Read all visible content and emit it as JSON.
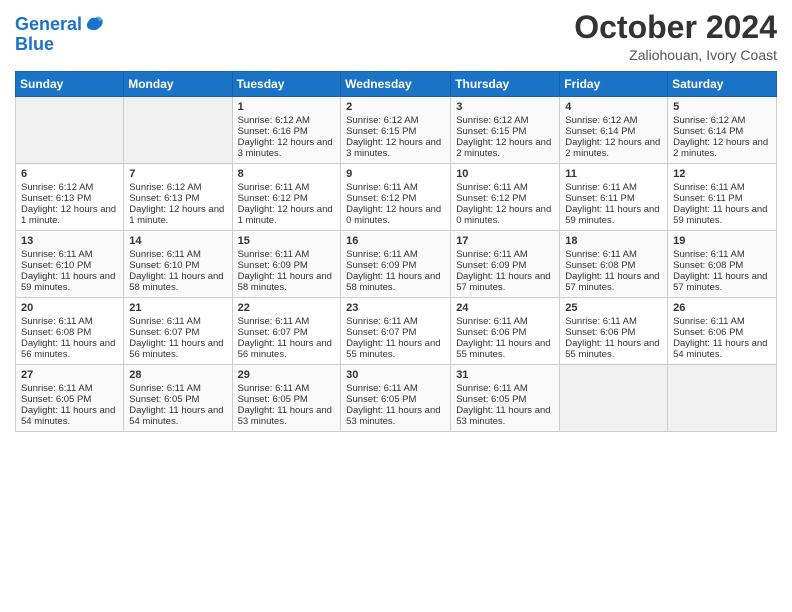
{
  "logo": {
    "line1": "General",
    "line2": "Blue"
  },
  "header": {
    "month_year": "October 2024",
    "location": "Zaliohouan, Ivory Coast"
  },
  "days_of_week": [
    "Sunday",
    "Monday",
    "Tuesday",
    "Wednesday",
    "Thursday",
    "Friday",
    "Saturday"
  ],
  "weeks": [
    [
      {
        "day": "",
        "empty": true
      },
      {
        "day": "",
        "empty": true
      },
      {
        "day": "1",
        "sunrise": "Sunrise: 6:12 AM",
        "sunset": "Sunset: 6:16 PM",
        "daylight": "Daylight: 12 hours and 3 minutes."
      },
      {
        "day": "2",
        "sunrise": "Sunrise: 6:12 AM",
        "sunset": "Sunset: 6:15 PM",
        "daylight": "Daylight: 12 hours and 3 minutes."
      },
      {
        "day": "3",
        "sunrise": "Sunrise: 6:12 AM",
        "sunset": "Sunset: 6:15 PM",
        "daylight": "Daylight: 12 hours and 2 minutes."
      },
      {
        "day": "4",
        "sunrise": "Sunrise: 6:12 AM",
        "sunset": "Sunset: 6:14 PM",
        "daylight": "Daylight: 12 hours and 2 minutes."
      },
      {
        "day": "5",
        "sunrise": "Sunrise: 6:12 AM",
        "sunset": "Sunset: 6:14 PM",
        "daylight": "Daylight: 12 hours and 2 minutes."
      }
    ],
    [
      {
        "day": "6",
        "sunrise": "Sunrise: 6:12 AM",
        "sunset": "Sunset: 6:13 PM",
        "daylight": "Daylight: 12 hours and 1 minute."
      },
      {
        "day": "7",
        "sunrise": "Sunrise: 6:12 AM",
        "sunset": "Sunset: 6:13 PM",
        "daylight": "Daylight: 12 hours and 1 minute."
      },
      {
        "day": "8",
        "sunrise": "Sunrise: 6:11 AM",
        "sunset": "Sunset: 6:12 PM",
        "daylight": "Daylight: 12 hours and 1 minute."
      },
      {
        "day": "9",
        "sunrise": "Sunrise: 6:11 AM",
        "sunset": "Sunset: 6:12 PM",
        "daylight": "Daylight: 12 hours and 0 minutes."
      },
      {
        "day": "10",
        "sunrise": "Sunrise: 6:11 AM",
        "sunset": "Sunset: 6:12 PM",
        "daylight": "Daylight: 12 hours and 0 minutes."
      },
      {
        "day": "11",
        "sunrise": "Sunrise: 6:11 AM",
        "sunset": "Sunset: 6:11 PM",
        "daylight": "Daylight: 11 hours and 59 minutes."
      },
      {
        "day": "12",
        "sunrise": "Sunrise: 6:11 AM",
        "sunset": "Sunset: 6:11 PM",
        "daylight": "Daylight: 11 hours and 59 minutes."
      }
    ],
    [
      {
        "day": "13",
        "sunrise": "Sunrise: 6:11 AM",
        "sunset": "Sunset: 6:10 PM",
        "daylight": "Daylight: 11 hours and 59 minutes."
      },
      {
        "day": "14",
        "sunrise": "Sunrise: 6:11 AM",
        "sunset": "Sunset: 6:10 PM",
        "daylight": "Daylight: 11 hours and 58 minutes."
      },
      {
        "day": "15",
        "sunrise": "Sunrise: 6:11 AM",
        "sunset": "Sunset: 6:09 PM",
        "daylight": "Daylight: 11 hours and 58 minutes."
      },
      {
        "day": "16",
        "sunrise": "Sunrise: 6:11 AM",
        "sunset": "Sunset: 6:09 PM",
        "daylight": "Daylight: 11 hours and 58 minutes."
      },
      {
        "day": "17",
        "sunrise": "Sunrise: 6:11 AM",
        "sunset": "Sunset: 6:09 PM",
        "daylight": "Daylight: 11 hours and 57 minutes."
      },
      {
        "day": "18",
        "sunrise": "Sunrise: 6:11 AM",
        "sunset": "Sunset: 6:08 PM",
        "daylight": "Daylight: 11 hours and 57 minutes."
      },
      {
        "day": "19",
        "sunrise": "Sunrise: 6:11 AM",
        "sunset": "Sunset: 6:08 PM",
        "daylight": "Daylight: 11 hours and 57 minutes."
      }
    ],
    [
      {
        "day": "20",
        "sunrise": "Sunrise: 6:11 AM",
        "sunset": "Sunset: 6:08 PM",
        "daylight": "Daylight: 11 hours and 56 minutes."
      },
      {
        "day": "21",
        "sunrise": "Sunrise: 6:11 AM",
        "sunset": "Sunset: 6:07 PM",
        "daylight": "Daylight: 11 hours and 56 minutes."
      },
      {
        "day": "22",
        "sunrise": "Sunrise: 6:11 AM",
        "sunset": "Sunset: 6:07 PM",
        "daylight": "Daylight: 11 hours and 56 minutes."
      },
      {
        "day": "23",
        "sunrise": "Sunrise: 6:11 AM",
        "sunset": "Sunset: 6:07 PM",
        "daylight": "Daylight: 11 hours and 55 minutes."
      },
      {
        "day": "24",
        "sunrise": "Sunrise: 6:11 AM",
        "sunset": "Sunset: 6:06 PM",
        "daylight": "Daylight: 11 hours and 55 minutes."
      },
      {
        "day": "25",
        "sunrise": "Sunrise: 6:11 AM",
        "sunset": "Sunset: 6:06 PM",
        "daylight": "Daylight: 11 hours and 55 minutes."
      },
      {
        "day": "26",
        "sunrise": "Sunrise: 6:11 AM",
        "sunset": "Sunset: 6:06 PM",
        "daylight": "Daylight: 11 hours and 54 minutes."
      }
    ],
    [
      {
        "day": "27",
        "sunrise": "Sunrise: 6:11 AM",
        "sunset": "Sunset: 6:05 PM",
        "daylight": "Daylight: 11 hours and 54 minutes."
      },
      {
        "day": "28",
        "sunrise": "Sunrise: 6:11 AM",
        "sunset": "Sunset: 6:05 PM",
        "daylight": "Daylight: 11 hours and 54 minutes."
      },
      {
        "day": "29",
        "sunrise": "Sunrise: 6:11 AM",
        "sunset": "Sunset: 6:05 PM",
        "daylight": "Daylight: 11 hours and 53 minutes."
      },
      {
        "day": "30",
        "sunrise": "Sunrise: 6:11 AM",
        "sunset": "Sunset: 6:05 PM",
        "daylight": "Daylight: 11 hours and 53 minutes."
      },
      {
        "day": "31",
        "sunrise": "Sunrise: 6:11 AM",
        "sunset": "Sunset: 6:05 PM",
        "daylight": "Daylight: 11 hours and 53 minutes."
      },
      {
        "day": "",
        "empty": true
      },
      {
        "day": "",
        "empty": true
      }
    ]
  ]
}
